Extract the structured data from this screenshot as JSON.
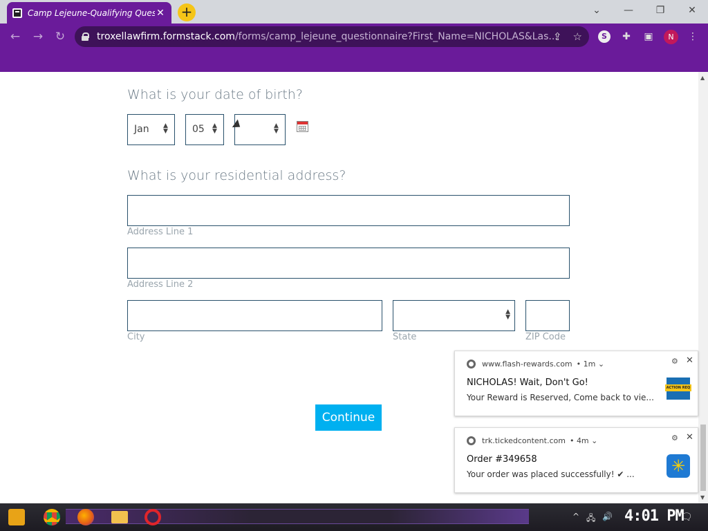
{
  "browser": {
    "tab_title": "Camp Lejeune-Qualifying Ques",
    "tab_close": "✕",
    "new_tab": "+",
    "url_host": "troxellawfirm.formstack.com",
    "url_path": "/forms/camp_lejeune_questionnaire?First_Name=NICHOLAS&Las...",
    "profile_initial": "N"
  },
  "form": {
    "dob_question": "What is your date of birth?",
    "dob_month": "Jan",
    "dob_day": "05",
    "dob_year": "",
    "address_question": "What is your residential address?",
    "address_line1_label": "Address Line 1",
    "address_line2_label": "Address Line 2",
    "city_label": "City",
    "state_label": "State",
    "zip_label": "ZIP Code",
    "continue_label": "Continue"
  },
  "notifications": [
    {
      "source": "www.flash-rewards.com",
      "age": "• 1m ⌄",
      "title": "NICHOLAS! Wait, Don't Go!",
      "message": "Your Reward is Reserved, Come back to vie...",
      "thumb_tag": "ACTION REQ"
    },
    {
      "source": "trk.tickedcontent.com",
      "age": "• 4m ⌄",
      "title": "Order #349658",
      "message": "Your order was placed successfully! ✔ ...",
      "thumb_glyph": "✳"
    }
  ],
  "taskbar": {
    "clock": "4:01 PM"
  },
  "colors": {
    "browser_purple": "#6a1b9a",
    "continue_button": "#00b0f0",
    "field_border": "#28506b"
  }
}
